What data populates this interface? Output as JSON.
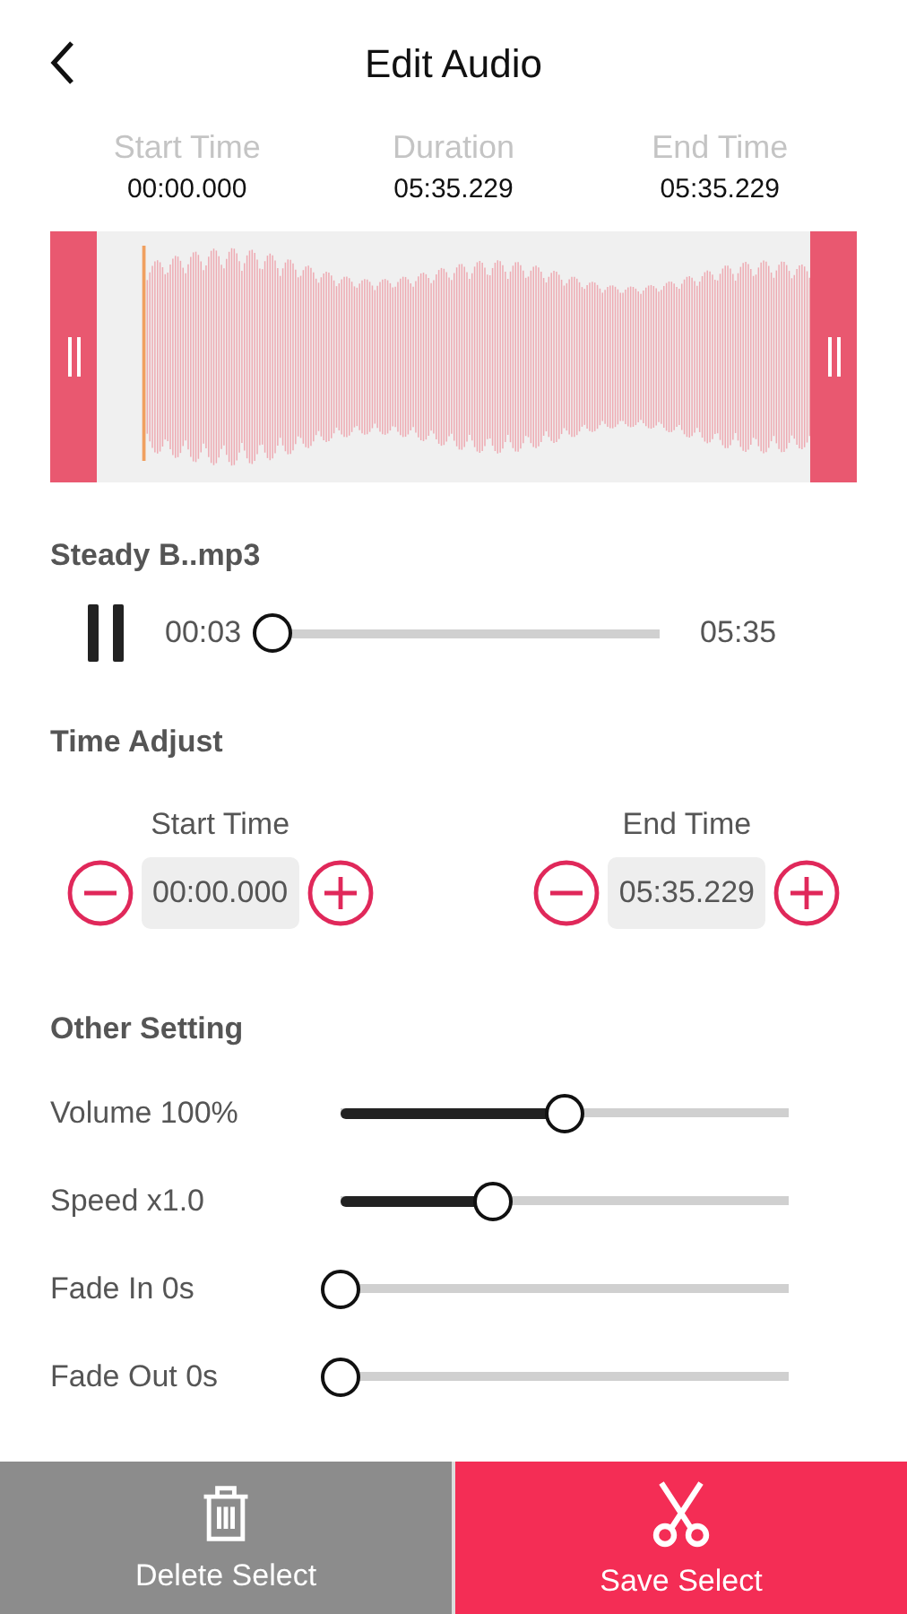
{
  "header": {
    "title": "Edit Audio"
  },
  "times": [
    {
      "label": "Start Time",
      "value": "00:00.000"
    },
    {
      "label": "Duration",
      "value": "05:35.229"
    },
    {
      "label": "End Time",
      "value": "05:35.229"
    }
  ],
  "player": {
    "file_name": "Steady B..mp3",
    "playing": true,
    "elapsed": "00:03",
    "total": "05:35",
    "level": 0.01
  },
  "time_adjust": {
    "title": "Time Adjust",
    "fields": [
      {
        "label": "Start Time",
        "value": "00:00.000"
      },
      {
        "label": "End Time",
        "value": "05:35.229"
      }
    ]
  },
  "other_setting": {
    "title": "Other Setting",
    "sliders": [
      {
        "label": "Volume 100%",
        "level": 0.5
      },
      {
        "label": "Speed x1.0",
        "level": 0.34
      },
      {
        "label": "Fade In 0s",
        "level": 0
      },
      {
        "label": "Fade Out 0s",
        "level": 0
      }
    ]
  },
  "actions": [
    {
      "kind": "delete",
      "label": "Delete Select"
    },
    {
      "kind": "save",
      "label": "Save Select"
    }
  ]
}
